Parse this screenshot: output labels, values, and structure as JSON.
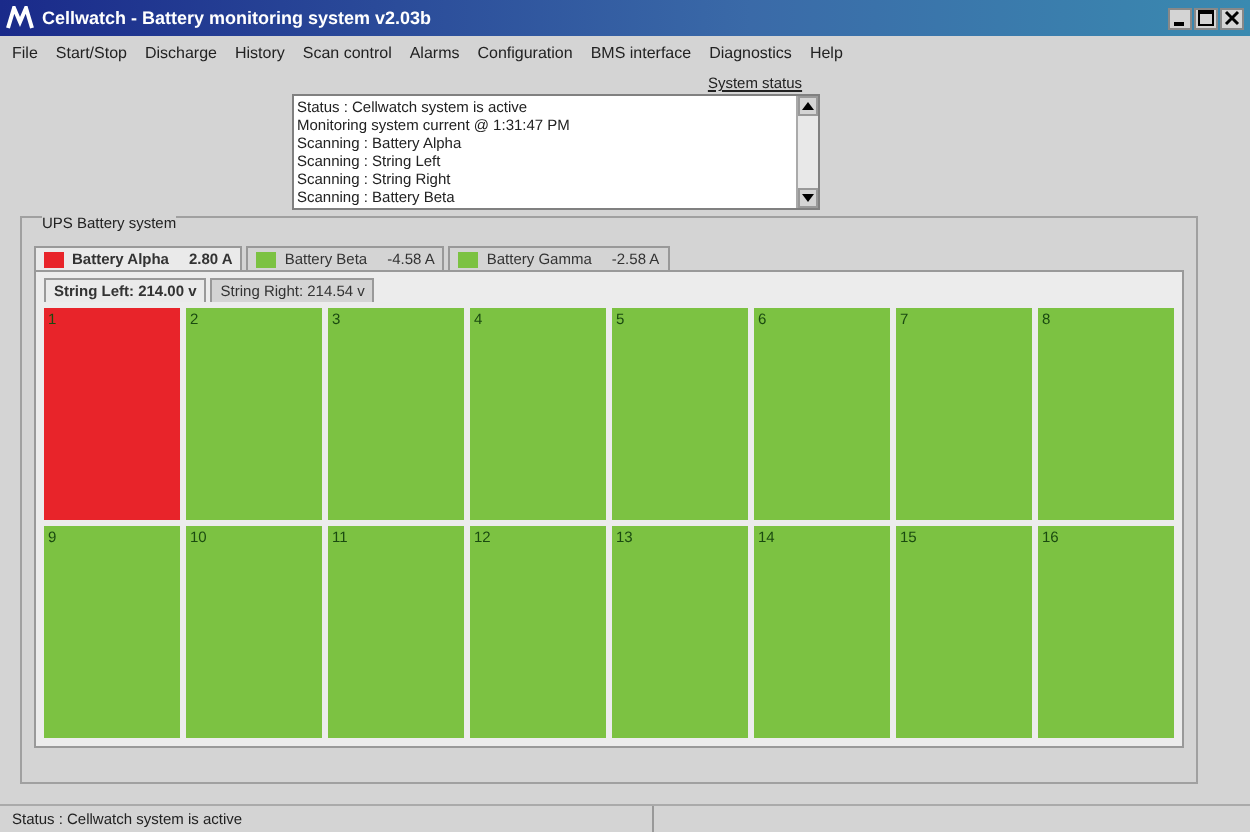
{
  "window": {
    "title": "Cellwatch  -  Battery monitoring system v2.03b"
  },
  "menu": [
    "File",
    "Start/Stop",
    "Discharge",
    "History",
    "Scan control",
    "Alarms",
    "Configuration",
    "BMS interface",
    "Diagnostics",
    "Help"
  ],
  "system_status": {
    "label": "System status",
    "lines": [
      "Status : Cellwatch system is active",
      "Monitoring system current @ 1:31:47 PM",
      "Scanning : Battery Alpha",
      "Scanning : String Left",
      "Scanning : String Right",
      "Scanning : Battery Beta"
    ]
  },
  "group": {
    "title": "UPS Battery system"
  },
  "battery_tabs": [
    {
      "name": "Battery Alpha",
      "reading": "2.80 A",
      "color": "#e8242a",
      "selected": true
    },
    {
      "name": "Battery Beta",
      "reading": "-4.58 A",
      "color": "#7cc242",
      "selected": false
    },
    {
      "name": "Battery Gamma",
      "reading": "-2.58 A",
      "color": "#7cc242",
      "selected": false
    }
  ],
  "string_tabs": [
    {
      "label": "String Left: 214.00 v",
      "selected": true
    },
    {
      "label": "String Right: 214.54 v",
      "selected": false
    }
  ],
  "cells": [
    {
      "number": "1",
      "color": "#e8242a"
    },
    {
      "number": "2",
      "color": "#7cc242"
    },
    {
      "number": "3",
      "color": "#7cc242"
    },
    {
      "number": "4",
      "color": "#7cc242"
    },
    {
      "number": "5",
      "color": "#7cc242"
    },
    {
      "number": "6",
      "color": "#7cc242"
    },
    {
      "number": "7",
      "color": "#7cc242"
    },
    {
      "number": "8",
      "color": "#7cc242"
    },
    {
      "number": "9",
      "color": "#7cc242"
    },
    {
      "number": "10",
      "color": "#7cc242"
    },
    {
      "number": "11",
      "color": "#7cc242"
    },
    {
      "number": "12",
      "color": "#7cc242"
    },
    {
      "number": "13",
      "color": "#7cc242"
    },
    {
      "number": "14",
      "color": "#7cc242"
    },
    {
      "number": "15",
      "color": "#7cc242"
    },
    {
      "number": "16",
      "color": "#7cc242"
    }
  ],
  "status_bar": {
    "text": "Status : Cellwatch system is active"
  }
}
